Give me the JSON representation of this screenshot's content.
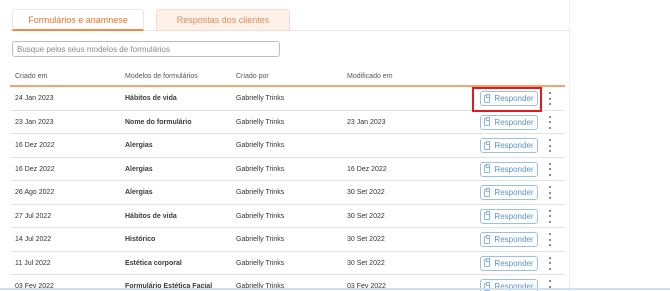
{
  "tabs": [
    {
      "label": "Formulários e anamnese",
      "active": true
    },
    {
      "label": "Respostas dos clientes",
      "active": false
    }
  ],
  "search": {
    "placeholder": "Busque pelos seus modelos de formulários",
    "value": ""
  },
  "table": {
    "headers": [
      "Criado em",
      "Modelos de formulários",
      "Criado por",
      "Modificado em"
    ],
    "rows": [
      {
        "created": "24 Jan 2023",
        "model": "Hábitos de vida",
        "author": "Gabrielly Trinks",
        "modified": "",
        "button": "Responder"
      },
      {
        "created": "23 Jan 2023",
        "model": "Nome do formulário",
        "author": "Gabrielly Trinks",
        "modified": "23 Jan 2023",
        "button": "Responder"
      },
      {
        "created": "16 Dez 2022",
        "model": "Alergias",
        "author": "Gabrielly Trinks",
        "modified": "",
        "button": "Responder"
      },
      {
        "created": "16 Dez 2022",
        "model": "Alergias",
        "author": "Gabrielly Trinks",
        "modified": "16 Dez 2022",
        "button": "Responder"
      },
      {
        "created": "26 Ago 2022",
        "model": "Alergias",
        "author": "Gabrielly Trinks",
        "modified": "30 Set 2022",
        "button": "Responder"
      },
      {
        "created": "27 Jul 2022",
        "model": "Hábitos de vida",
        "author": "Gabrielly Trinks",
        "modified": "30 Set 2022",
        "button": "Responder"
      },
      {
        "created": "14 Jul 2022",
        "model": "Histórico",
        "author": "Gabrielly Trinks",
        "modified": "30 Set 2022",
        "button": "Responder"
      },
      {
        "created": "11 Jul 2022",
        "model": "Estética corporal",
        "author": "Gabrielly Trinks",
        "modified": "30 Set 2022",
        "button": "Responder"
      },
      {
        "created": "03 Fev 2022",
        "model": "Formulário Estética Facial",
        "author": "Gabrielly Trinks",
        "modified": "03 Fev 2022",
        "button": "Responder"
      }
    ]
  },
  "colors": {
    "accent": "#f08a4b",
    "button": "#5b93c7",
    "highlight": "#e01b1b"
  },
  "icons": {
    "button_icon": "clipboard-icon",
    "row_menu": "more-vertical-icon"
  }
}
